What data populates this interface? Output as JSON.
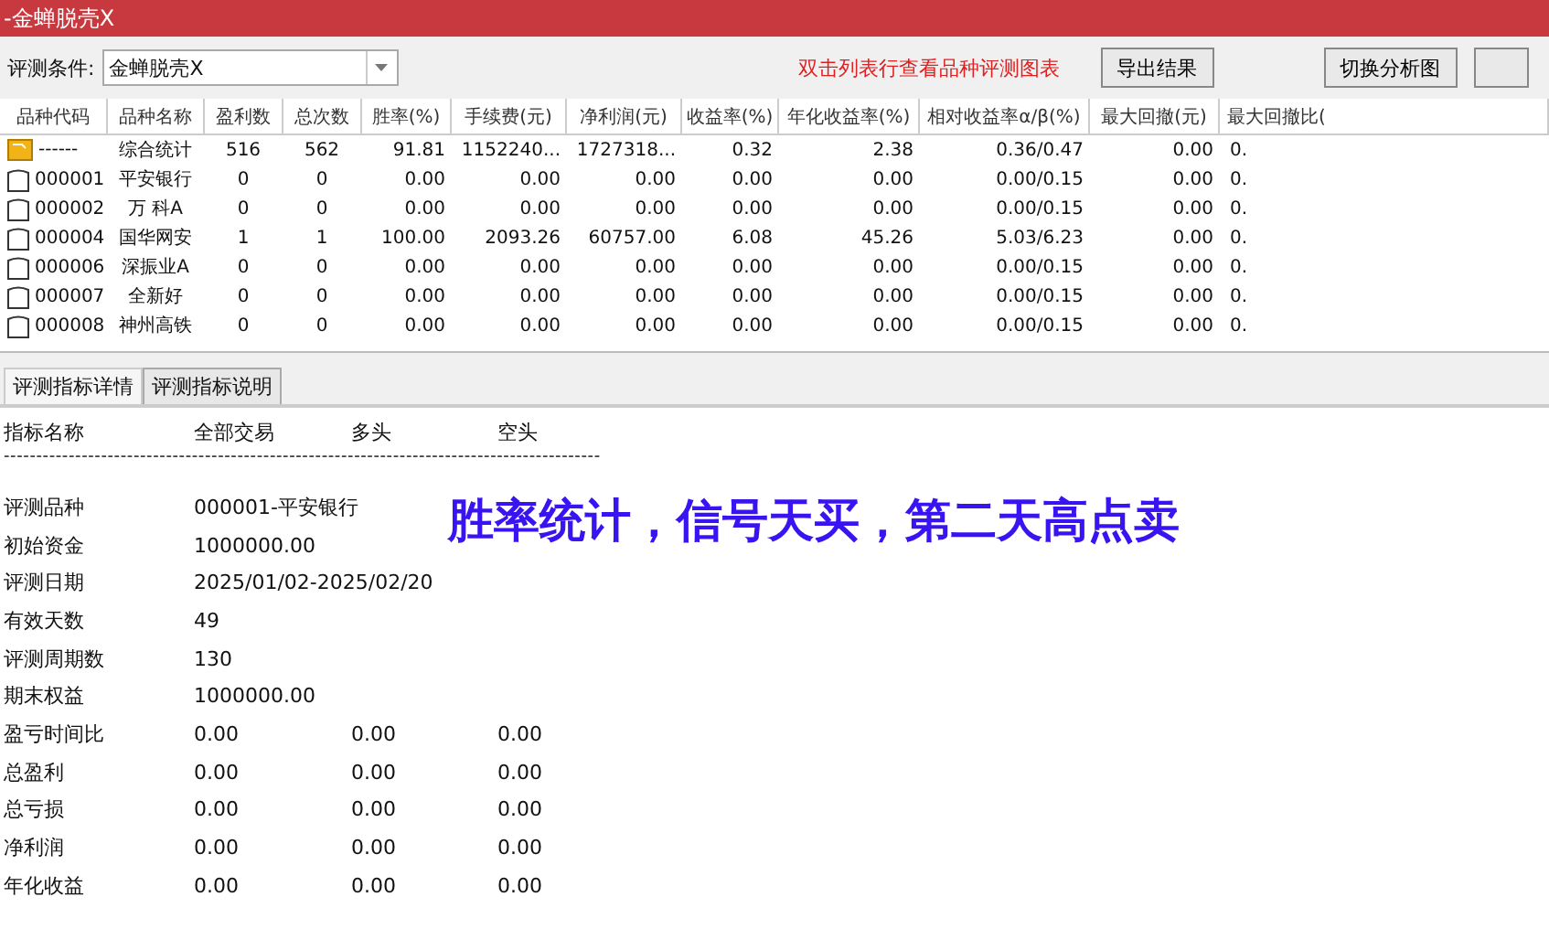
{
  "window": {
    "title": "-金蝉脱壳X"
  },
  "toolbar": {
    "condition_label": "评测条件:",
    "condition_value": "金蝉脱壳X",
    "hint": "双击列表行查看品种评测图表",
    "buttons": [
      {
        "label": "导出结果"
      },
      {
        "label": "切换分析图"
      }
    ]
  },
  "table": {
    "columns": [
      "品种代码",
      "品种名称",
      "盈利数",
      "总次数",
      "胜率(%)",
      "手续费(元)",
      "净利润(元)",
      "收益率(%)",
      "年化收益率(%)",
      "相对收益率α/β(%)",
      "最大回撤(元)",
      "最大回撤比("
    ],
    "rows": [
      {
        "kind": "summary",
        "cells": [
          "------",
          "综合统计",
          "516",
          "562",
          "91.81",
          "1152240...",
          "1727318...",
          "0.32",
          "2.38",
          "0.36/0.47",
          "0.00",
          "0."
        ]
      },
      {
        "kind": "stock",
        "cells": [
          "000001",
          "平安银行",
          "0",
          "0",
          "0.00",
          "0.00",
          "0.00",
          "0.00",
          "0.00",
          "0.00/0.15",
          "0.00",
          "0."
        ]
      },
      {
        "kind": "stock",
        "cells": [
          "000002",
          "万 科A",
          "0",
          "0",
          "0.00",
          "0.00",
          "0.00",
          "0.00",
          "0.00",
          "0.00/0.15",
          "0.00",
          "0."
        ]
      },
      {
        "kind": "stock",
        "cells": [
          "000004",
          "国华网安",
          "1",
          "1",
          "100.00",
          "2093.26",
          "60757.00",
          "6.08",
          "45.26",
          "5.03/6.23",
          "0.00",
          "0."
        ]
      },
      {
        "kind": "stock",
        "cells": [
          "000006",
          "深振业A",
          "0",
          "0",
          "0.00",
          "0.00",
          "0.00",
          "0.00",
          "0.00",
          "0.00/0.15",
          "0.00",
          "0."
        ]
      },
      {
        "kind": "stock",
        "cells": [
          "000007",
          "全新好",
          "0",
          "0",
          "0.00",
          "0.00",
          "0.00",
          "0.00",
          "0.00",
          "0.00/0.15",
          "0.00",
          "0."
        ]
      },
      {
        "kind": "stock",
        "cells": [
          "000008",
          "神州高铁",
          "0",
          "0",
          "0.00",
          "0.00",
          "0.00",
          "0.00",
          "0.00",
          "0.00/0.15",
          "0.00",
          "0."
        ]
      }
    ]
  },
  "tabs": [
    {
      "label": "评测指标详情",
      "selected": true
    },
    {
      "label": "评测指标说明",
      "selected": false
    }
  ],
  "details": {
    "header": [
      "指标名称",
      "全部交易",
      "多头",
      "空头"
    ],
    "divider": "--------------------------------------------------------------------------------------------",
    "rows": [
      {
        "label": "评测品种",
        "values": [
          "000001-平安银行"
        ]
      },
      {
        "label": "初始资金",
        "values": [
          "1000000.00"
        ]
      },
      {
        "label": "评测日期",
        "values": [
          "2025/01/02-2025/02/20"
        ]
      },
      {
        "label": "有效天数",
        "values": [
          "49"
        ]
      },
      {
        "label": "评测周期数",
        "values": [
          "130"
        ]
      },
      {
        "label": "期末权益",
        "values": [
          "1000000.00"
        ]
      },
      {
        "label": "盈亏时间比",
        "values": [
          "0.00",
          "0.00",
          "0.00"
        ]
      },
      {
        "label": "总盈利",
        "values": [
          "0.00",
          "0.00",
          "0.00"
        ]
      },
      {
        "label": "总亏损",
        "values": [
          "0.00",
          "0.00",
          "0.00"
        ]
      },
      {
        "label": "净利润",
        "values": [
          "0.00",
          "0.00",
          "0.00"
        ]
      },
      {
        "label": "年化收益",
        "values": [
          "0.00",
          "0.00",
          "0.00"
        ]
      }
    ]
  },
  "caption": "胜率统计，信号天买，第二天高点卖"
}
